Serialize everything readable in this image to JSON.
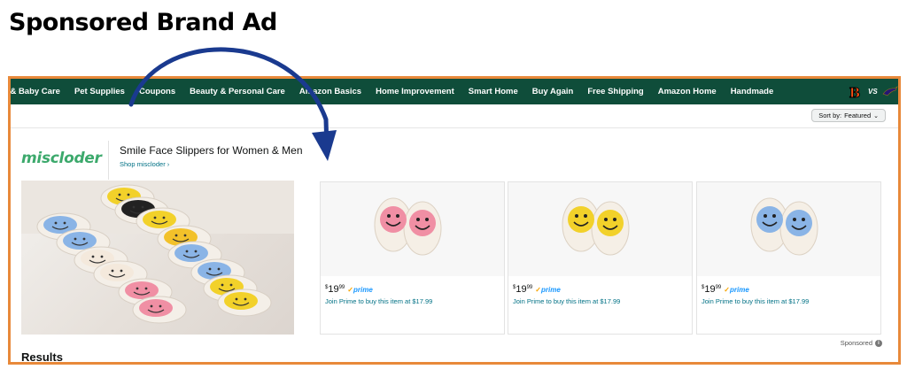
{
  "heading": "Sponsored Brand Ad",
  "nav": {
    "items": [
      "n & Baby Care",
      "Pet Supplies",
      "Coupons",
      "Beauty & Personal Care",
      "Amazon Basics",
      "Home Improvement",
      "Smart Home",
      "Buy Again",
      "Free Shipping",
      "Amazon Home",
      "Handmade"
    ],
    "vs_label": "VS"
  },
  "sort": {
    "label": "Sort by:",
    "value": "Featured"
  },
  "brand": {
    "logo": "miscloder",
    "headline": "Smile Face Slippers for Women & Men",
    "shop_link": "Shop miscloder ›"
  },
  "products": [
    {
      "color": "pink",
      "price_dollars": "19",
      "price_cents": "99",
      "prime": "prime",
      "join": "Join Prime to buy this item at $17.99"
    },
    {
      "color": "yellow",
      "price_dollars": "19",
      "price_cents": "99",
      "prime": "prime",
      "join": "Join Prime to buy this item at $17.99"
    },
    {
      "color": "blue",
      "price_dollars": "19",
      "price_cents": "99",
      "prime": "prime",
      "join": "Join Prime to buy this item at $17.99"
    }
  ],
  "currency": "$",
  "sponsored_label": "Sponsored",
  "results_label": "Results",
  "colors": {
    "nav_bg": "#0f4d3a",
    "frame_border": "#e8893a",
    "arrow": "#1a3a8f",
    "brand_green": "#3ca96c",
    "link": "#007185",
    "slipper_pink": "#f08fa4",
    "slipper_yellow": "#f2d12a",
    "slipper_blue": "#8ab4e6"
  },
  "icons": [
    "bengals-logo-icon",
    "ravens-logo-icon",
    "chevron-down-icon",
    "info-icon",
    "curved-arrow-icon"
  ]
}
